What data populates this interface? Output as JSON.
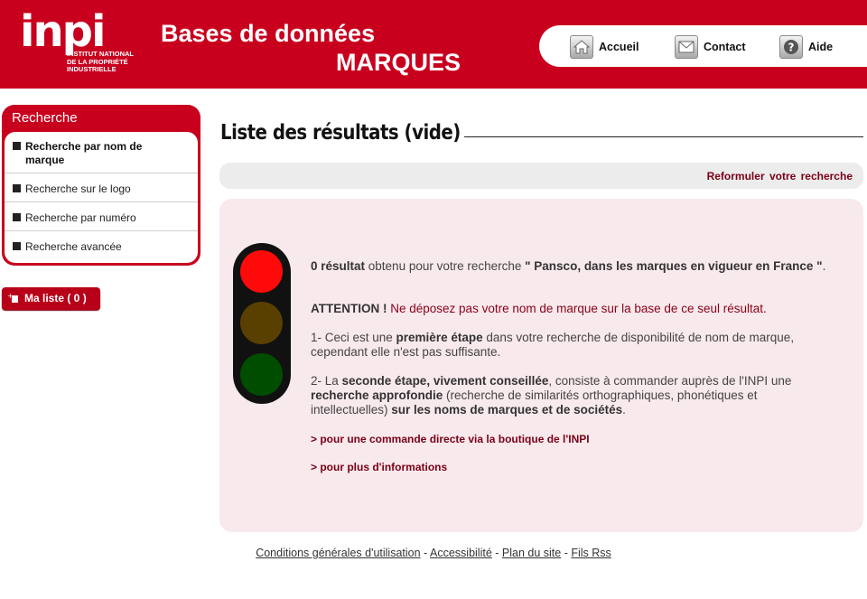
{
  "header": {
    "logo_mark": "inpi",
    "logo_sub": [
      "INSTITUT NATIONAL",
      "DE LA PROPRIÉTÉ",
      "INDUSTRIELLE"
    ],
    "title_line1": "Bases de données",
    "title_line2": "MARQUES",
    "nav": [
      {
        "label": "Accueil",
        "icon": "home-icon"
      },
      {
        "label": "Contact",
        "icon": "envelope-icon"
      },
      {
        "label": "Aide",
        "icon": "help-icon"
      }
    ]
  },
  "sidebar": {
    "title": "Recherche",
    "items": [
      {
        "label": "Recherche par nom de marque"
      },
      {
        "label": "Recherche sur le logo"
      },
      {
        "label": "Recherche par numéro"
      },
      {
        "label": "Recherche avancée"
      }
    ],
    "ma_liste": "Ma liste ( 0 )"
  },
  "main": {
    "title": "Liste des résultats (vide)",
    "reformuler": "Reformuler votre recherche",
    "result_count": "0 résultat",
    "result_text": " obtenu pour votre recherche ",
    "query": "\" Pansco, dans les marques en vigueur en France \"",
    "attention_label": "ATTENTION !",
    "attention_text": " Ne déposez pas votre nom de marque sur la base de ce seul résultat.",
    "step1_a": "1- Ceci est une ",
    "step1_b": "première étape",
    "step1_c": " dans votre recherche de disponibilité de nom de marque, cependant elle n'est pas suffisante.",
    "step2_a": "2- La ",
    "step2_b": "seconde étape, vivement conseillée",
    "step2_c": ", consiste à commander auprès de l'INPI une ",
    "step2_d": "recherche approfondie",
    "step2_e": " (recherche de similarités orthographiques, phonétiques et intellectuelles) ",
    "step2_f": "sur les noms de marques et de sociétés",
    "step2_g": ".",
    "link1": "> pour une commande directe via la boutique de l'INPI",
    "link2": "> pour plus d'informations",
    "traffic_light": {
      "state": "red",
      "colors": [
        "#ff0a0a",
        "#5a4000",
        "#004d00"
      ]
    }
  },
  "footer": {
    "links": [
      "Conditions générales d'utilisation",
      "Accessibilité",
      "Plan du site",
      "Fils Rss"
    ],
    "separator": " - "
  },
  "colors": {
    "brand": "#c8001e",
    "link": "#7a0016"
  }
}
